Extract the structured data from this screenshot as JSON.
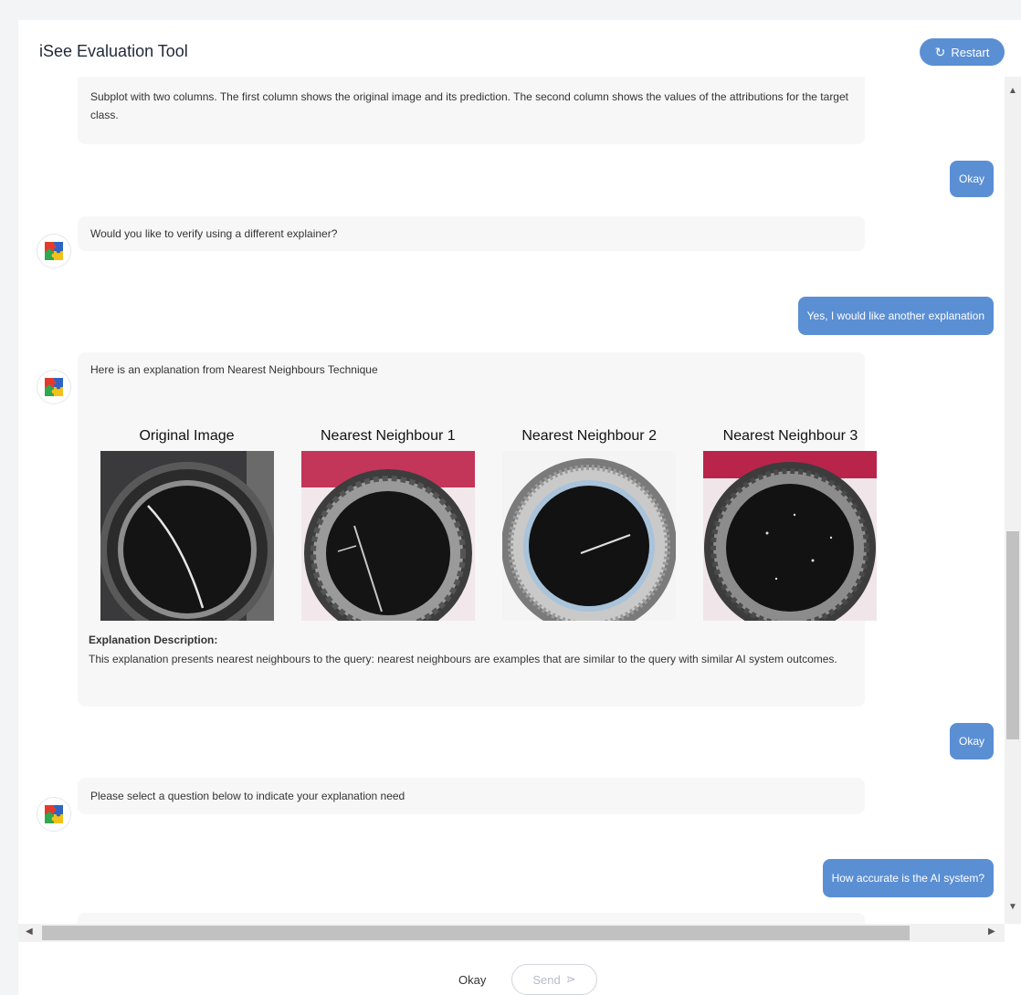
{
  "header": {
    "title": "iSee Evaluation Tool",
    "restart_label": "Restart"
  },
  "messages": {
    "m0_text": "Subplot with two columns. The first column shows the original image and its prediction. The second column shows the values of the attributions for the target class.",
    "m1_user": "Okay",
    "m2_bot": "Would you like to verify using a different explainer?",
    "m3_user": "Yes, I would like another explanation",
    "m4_bot": "Here is an explanation from Nearest Neighbours Technique",
    "m4_titles": [
      "Original Image",
      "Nearest Neighbour 1",
      "Nearest Neighbour 2",
      "Nearest Neighbour 3"
    ],
    "m4_desc_heading": "Explanation Description:",
    "m4_desc_text": "This explanation presents nearest neighbours to the query: nearest neighbours are examples that are similar to the query with similar AI system outcomes.",
    "m5_user": "Okay",
    "m6_bot": "Please select a question below to indicate your explanation need",
    "m7_user": "How accurate is the AI system?"
  },
  "footer": {
    "option_label": "Okay",
    "send_label": "Send"
  },
  "colors": {
    "accent": "#5b8fd4",
    "bubble_bg": "#f7f7f8"
  }
}
